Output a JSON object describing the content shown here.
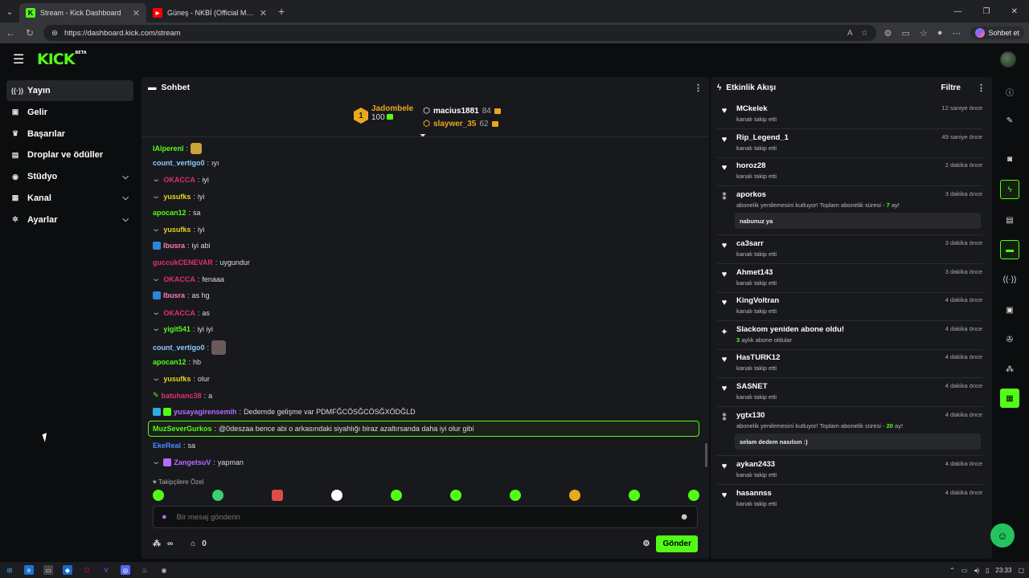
{
  "browser": {
    "tabs": [
      {
        "title": "Stream - Kick Dashboard",
        "icon": "kick-icon"
      },
      {
        "title": "Güneş - NKBİ (Official Music V",
        "icon": "youtube-icon"
      }
    ],
    "url": "https://dashboard.kick.com/stream",
    "copilot_label": "Sohbet et"
  },
  "app": {
    "logo": "KICK",
    "logo_beta": "BETA"
  },
  "sidebar": {
    "items": [
      {
        "label": "Yayın",
        "icon": "broadcast-icon",
        "active": true
      },
      {
        "label": "Gelir",
        "icon": "money-icon"
      },
      {
        "label": "Başarılar",
        "icon": "trophy-icon"
      },
      {
        "label": "Droplar ve ödüller",
        "icon": "gift-icon"
      },
      {
        "label": "Stüdyo",
        "icon": "studio-icon",
        "expandable": true
      },
      {
        "label": "Kanal",
        "icon": "channel-icon",
        "expandable": true
      },
      {
        "label": "Ayarlar",
        "icon": "settings-icon",
        "expandable": true
      }
    ]
  },
  "chat": {
    "title": "Sohbet",
    "leaderboard": {
      "first": {
        "rank": "1",
        "name": "Jadombele",
        "count": "100"
      },
      "others": [
        {
          "name": "macius1881",
          "count": "84"
        },
        {
          "name": "slaywer_35",
          "count": "62"
        }
      ]
    },
    "messages": [
      {
        "user": "IAlperenl",
        "text": "",
        "color": "#53fc18"
      },
      {
        "user": "count_vertigo0",
        "text": "ıyı",
        "color": "#8ecbff"
      },
      {
        "user": "OKACCA",
        "text": "iyi",
        "color": "#e1306c"
      },
      {
        "user": "yusufks",
        "text": "iyi",
        "color": "#e9d21c"
      },
      {
        "user": "apocan12",
        "text": "sa",
        "color": "#53fc18"
      },
      {
        "user": "yusufks",
        "text": "iyi",
        "color": "#e9d21c"
      },
      {
        "user": "lbusra",
        "text": "iyi abi",
        "color": "#ff7eb3"
      },
      {
        "user": "guccukCENEVAR",
        "text": "uygundur",
        "color": "#e1306c"
      },
      {
        "user": "OKACCA",
        "text": "fenaaa",
        "color": "#e1306c"
      },
      {
        "user": "lbusra",
        "text": "as hg",
        "color": "#ff7eb3"
      },
      {
        "user": "OKACCA",
        "text": "as",
        "color": "#e1306c"
      },
      {
        "user": "yigit541",
        "text": "iyi iyi",
        "color": "#53fc18"
      },
      {
        "user": "count_vertigo0",
        "text": "",
        "color": "#8ecbff"
      },
      {
        "user": "apocan12",
        "text": "hb",
        "color": "#53fc18"
      },
      {
        "user": "yusufks",
        "text": "olur",
        "color": "#e9d21c"
      },
      {
        "user": "batuhanc38",
        "text": "a",
        "color": "#e1306c"
      },
      {
        "user": "yusayagirensemih",
        "text": "Dedemde gelişme var PDMFĞCÖSĞCÖSĞXÖDĞLD",
        "color": "#b36bff"
      },
      {
        "user": "MuzSeverGurkos",
        "text": "@0deszaa bence abi o arkasındaki siyahlığı biraz azaltırsanda daha iyi olur gibi",
        "color": "#53fc18"
      },
      {
        "user": "EkeReal",
        "text": "sa",
        "color": "#4a8cff"
      },
      {
        "user": "ZangetsuV",
        "text": "yapman",
        "color": "#b36bff"
      }
    ],
    "followers_only": "Takipçilere Özel",
    "input_placeholder": "Bir mesaj gönderin",
    "viewers": "0",
    "send_label": "Gönder"
  },
  "activity": {
    "title": "Etkinlik Akışı",
    "filter_label": "Filtre",
    "items": [
      {
        "name": "MCkelek",
        "sub": "kanalı takip etti",
        "time": "12 saniye önce",
        "type": "follow"
      },
      {
        "name": "Rip_Legend_1",
        "sub": "kanalı takip etti",
        "time": "49 saniye önce",
        "type": "follow"
      },
      {
        "name": "horoz28",
        "sub": "kanalı takip etti",
        "time": "2 dakika önce",
        "type": "follow"
      },
      {
        "name": "aporkos",
        "sub": "abonelik yenilemesini kutluyor! Toplam abonelik süresi - ",
        "sub_highlight": "7",
        "sub_tail": " ay!",
        "quote": "nabunuz ya",
        "time": "3 dakika önce",
        "type": "resub"
      },
      {
        "name": "ca3sarr",
        "sub": "kanalı takip etti",
        "time": "3 dakika önce",
        "type": "follow"
      },
      {
        "name": "Ahmet143",
        "sub": "kanalı takip etti",
        "time": "3 dakika önce",
        "type": "follow"
      },
      {
        "name": "KingVoltran",
        "sub": "kanalı takip etti",
        "time": "4 dakika önce",
        "type": "follow"
      },
      {
        "name": "Slackom yeniden abone oldu!",
        "sub": "",
        "sub_highlight": "3",
        "sub_tail": " aylık abone oldular",
        "time": "4 dakika önce",
        "type": "sub"
      },
      {
        "name": "HasTURK12",
        "sub": "kanalı takip etti",
        "time": "4 dakika önce",
        "type": "follow"
      },
      {
        "name": "SASNET",
        "sub": "kanalı takip etti",
        "time": "4 dakika önce",
        "type": "follow"
      },
      {
        "name": "ygtx130",
        "sub": "abonelik yenilemesini kutluyor! Toplam abonelik süresi - ",
        "sub_highlight": "20",
        "sub_tail": " ay!",
        "quote": "selam dedem nasılsın :)",
        "time": "4 dakika önce",
        "type": "resub"
      },
      {
        "name": "aykan2433",
        "sub": "kanalı takip etti",
        "time": "4 dakika önce",
        "type": "follow"
      },
      {
        "name": "hasannss",
        "sub": "kanalı takip etti",
        "time": "4 dakika önce",
        "type": "follow"
      }
    ]
  },
  "taskbar": {
    "time": "23:33"
  },
  "colors": {
    "accent": "#53fc18",
    "panel": "#18191c",
    "bg": "#0b0d0f"
  }
}
